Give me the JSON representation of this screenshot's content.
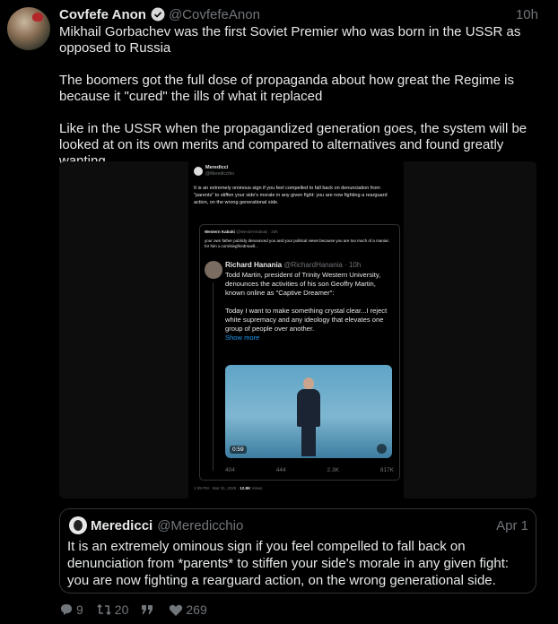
{
  "post": {
    "author": "Covfefe Anon",
    "handle": "@CovfefeAnon",
    "time": "10h",
    "paragraphs": [
      "Mikhail Gorbachev was the first Soviet Premier who was born in the USSR as opposed to Russia",
      "The boomers got the full dose of propaganda about how great the Regime is because it \"cured\" the ills of what it replaced",
      "Like in the USSR when the propagandized generation goes, the system will be looked at on its own merits and compared to alternatives and found greatly wanting"
    ]
  },
  "screenshot": {
    "author": "Meredicci",
    "handle": "@Meredicchio",
    "text": "It is an extremely ominous sign if you feel compelled to fall back on denunciation from \"parents\" to stiffen your side's morale in any given fight: you are now fighting a rearguard action, on the wrong generational side.",
    "inner": {
      "wk_name": "Western Kabuki",
      "wk_handle": "@WesternKabuki · 23h",
      "wk_text": "your own father publicly denounced you and your political views because you are too much of a maniac for him x.com/siegfriedmuell...",
      "rh_name": "Richard Hanania",
      "rh_handle": "@RichardHanania · 10h",
      "rh_text": "Todd Martin, president of Trinity Western University, denounces the activities of his son Geoffry Martin, known online as \"Captive Dreamer\":",
      "rh_text2": "Today I want to make something crystal clear...I reject white supremacy and any ideology that elevates one group of people over another.",
      "show_more": "Show more",
      "video_time": "0:59",
      "stats": {
        "replies": "404",
        "reposts": "444",
        "likes": "2.3K",
        "views": "817K"
      }
    },
    "footer_time": "1:39 PM · Mar 31, 2025 · ",
    "footer_views": "12.8K",
    "footer_views_label": " Views"
  },
  "quote": {
    "author": "Meredicci",
    "handle": "@Meredicchio",
    "time": "Apr 1",
    "text": "It is an extremely ominous sign if you feel compelled to fall back on denunciation from *parents* to stiffen your side's morale in any given fight: you are now fighting a rearguard action, on the wrong generational side."
  },
  "actions": {
    "replies": "9",
    "reposts": "20",
    "likes": "269"
  },
  "colors": {
    "background": "#000000",
    "text": "#e7e9ea",
    "muted": "#71767b",
    "accent": "#1d9bf0",
    "border": "#2f3336"
  },
  "icons": [
    "verified-badge-icon",
    "reply-icon",
    "repost-icon",
    "quote-icon",
    "like-icon"
  ]
}
